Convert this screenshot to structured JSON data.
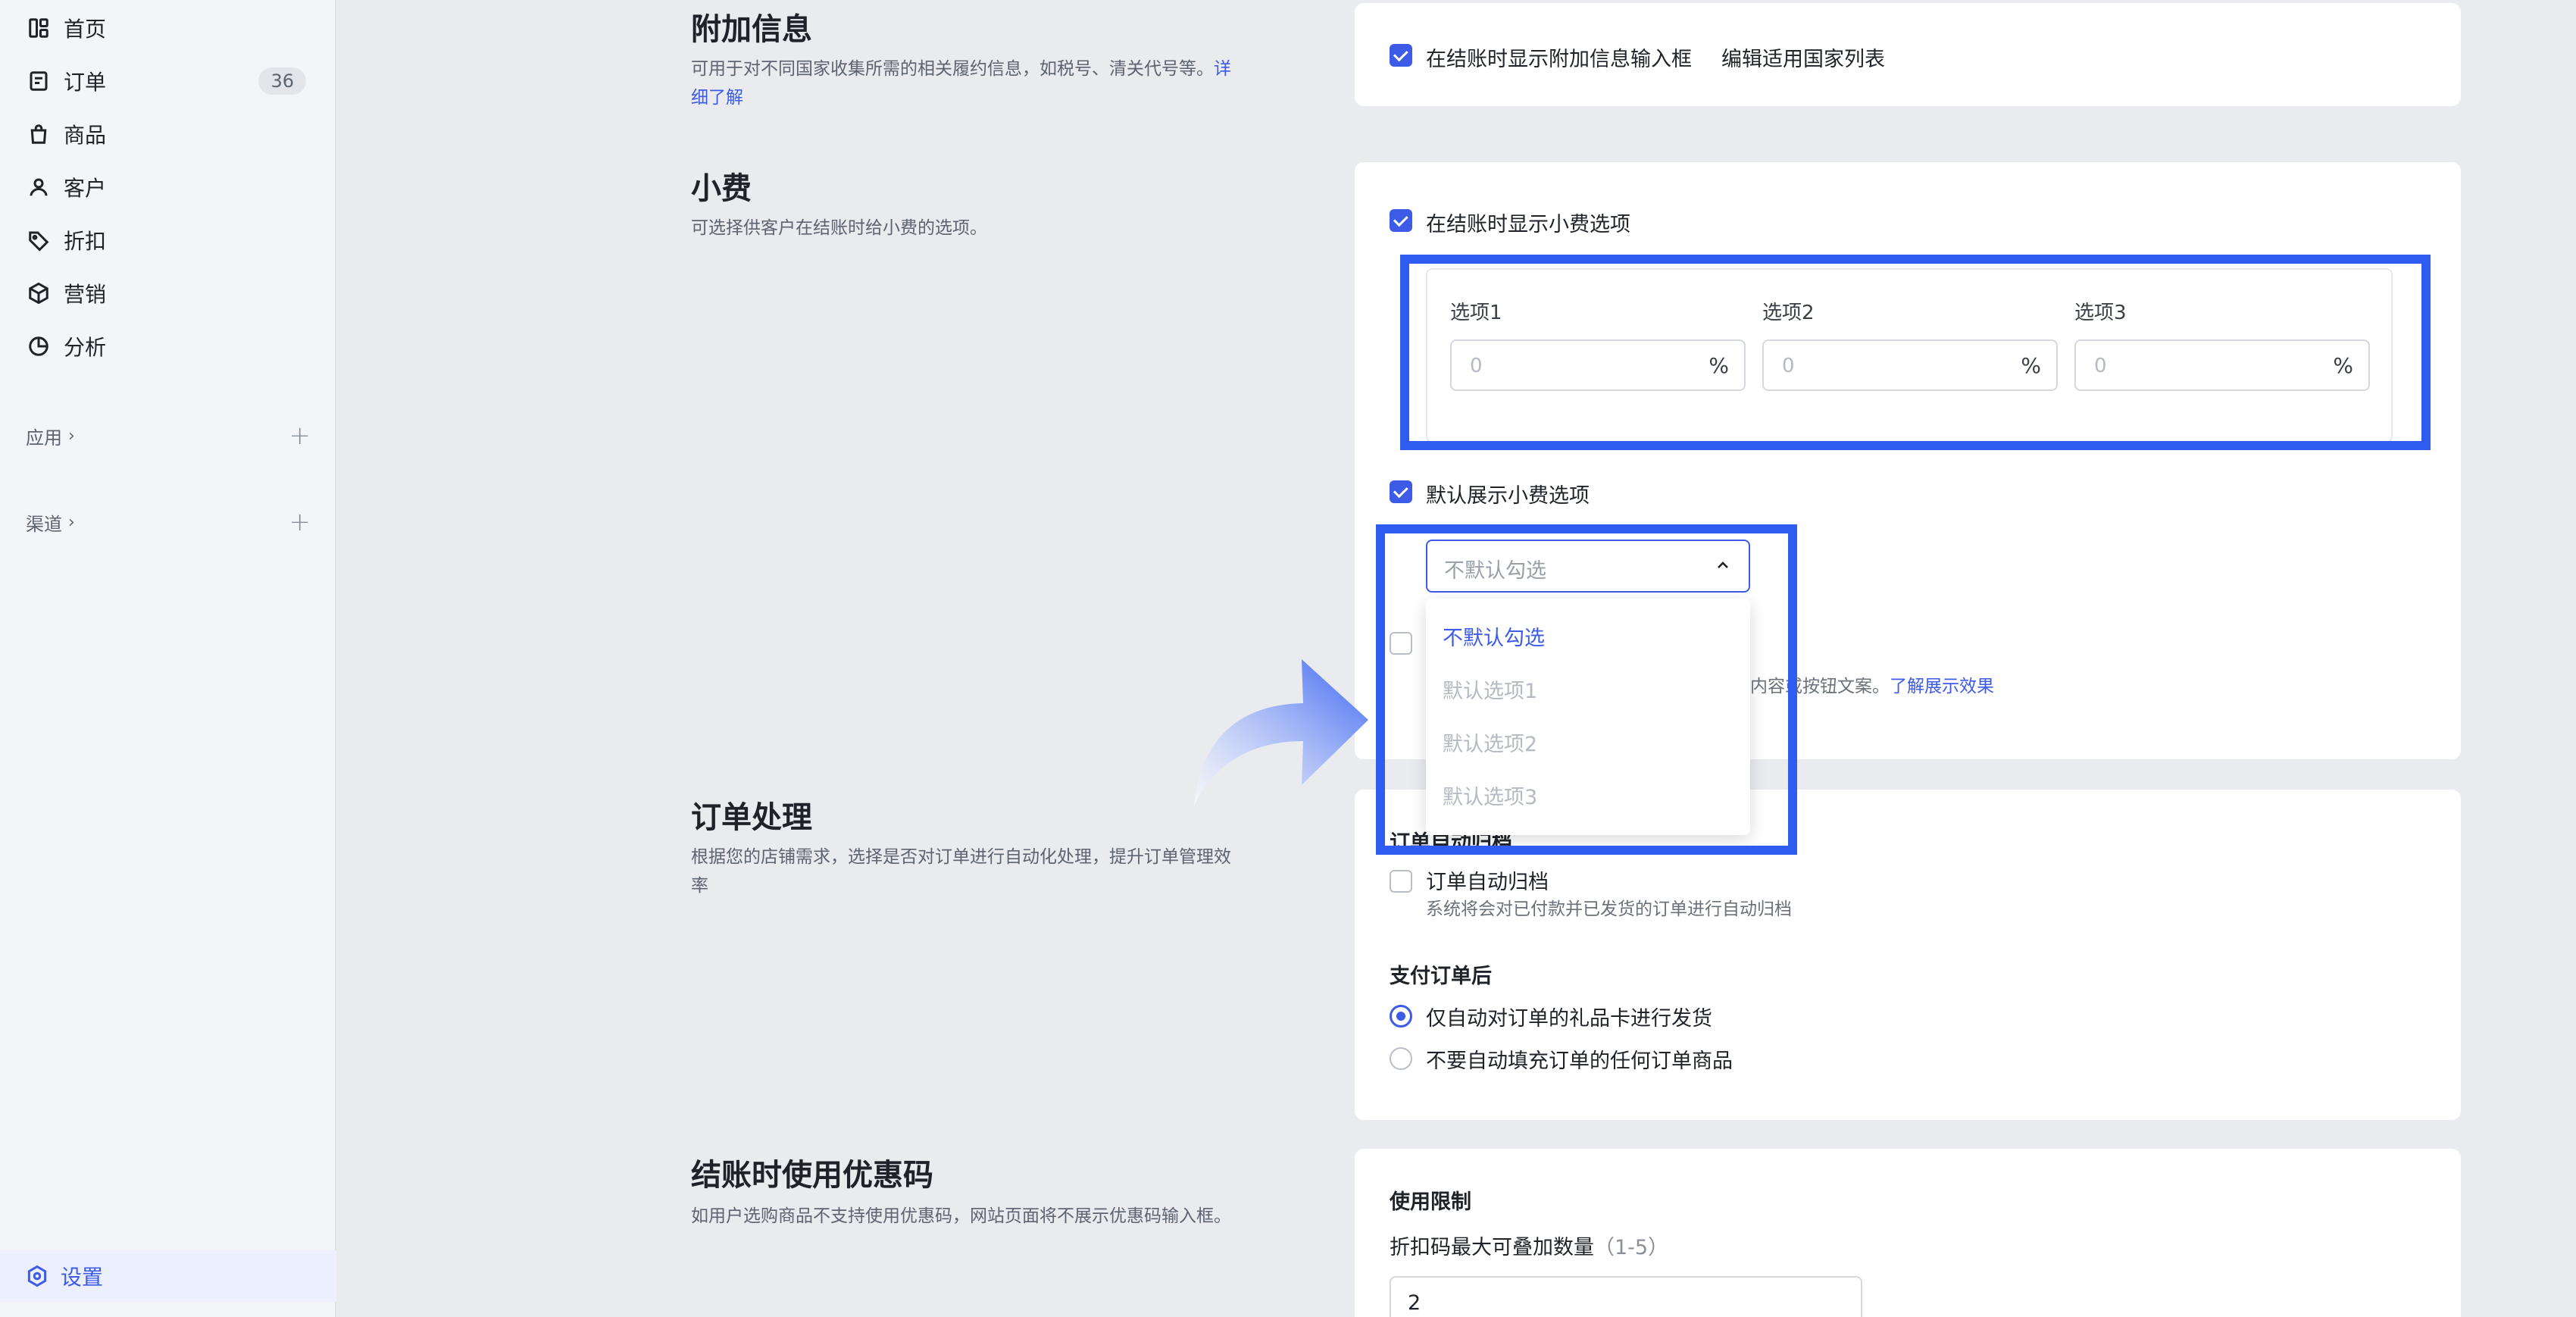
{
  "sidebar": {
    "items": [
      {
        "label": "首页"
      },
      {
        "label": "订单",
        "badge": "36"
      },
      {
        "label": "商品"
      },
      {
        "label": "客户"
      },
      {
        "label": "折扣"
      },
      {
        "label": "营销"
      },
      {
        "label": "分析"
      }
    ],
    "groups": [
      {
        "label": "应用"
      },
      {
        "label": "渠道"
      }
    ],
    "settings": "设置"
  },
  "additional_info": {
    "title": "附加信息",
    "desc": "可用于对不同国家收集所需的相关履约信息，如税号、清关代号等。",
    "desc_link": "详细了解",
    "checkbox_label": "在结账时显示附加信息输入框",
    "edit_link": "编辑适用国家列表"
  },
  "tips": {
    "title": "小费",
    "desc": "可选择供客户在结账时给小费的选项。",
    "show_label": "在结账时显示小费选项",
    "options": [
      {
        "label": "选项1",
        "placeholder": "0",
        "suffix": "%"
      },
      {
        "label": "选项2",
        "placeholder": "0",
        "suffix": "%"
      },
      {
        "label": "选项3",
        "placeholder": "0",
        "suffix": "%"
      }
    ],
    "default_label": "默认展示小费选项",
    "select_placeholder": "不默认勾选",
    "dropdown_options": [
      "不默认勾选",
      "默认选项1",
      "默认选项2",
      "默认选项3"
    ],
    "hidden_desc": "题、内容或按钮文案。",
    "hidden_link": "了解展示效果"
  },
  "order_processing": {
    "title": "订单处理",
    "desc": "根据您的店铺需求，选择是否对订单进行自动化处理，提升订单管理效率",
    "archive_heading": "订单自动归档",
    "archive_label": "订单自动归档",
    "archive_desc": "系统将会对已付款并已发货的订单进行自动归档",
    "after_pay_heading": "支付订单后",
    "radio_options": [
      "仅自动对订单的礼品卡进行发货",
      "不要自动填充订单的任何订单商品"
    ]
  },
  "coupon": {
    "title": "结账时使用优惠码",
    "desc": "如用户选购商品不支持使用优惠码，网站页面将不展示优惠码输入框。",
    "limit_heading": "使用限制",
    "max_label": "折扣码最大可叠加数量",
    "max_range": "（1-5）",
    "max_value": "2"
  },
  "colors": {
    "accent": "#3d5be6",
    "highlight": "#2f5cf0",
    "sidebar_bg": "#f4f5f8",
    "page_bg": "#e9ebef"
  }
}
